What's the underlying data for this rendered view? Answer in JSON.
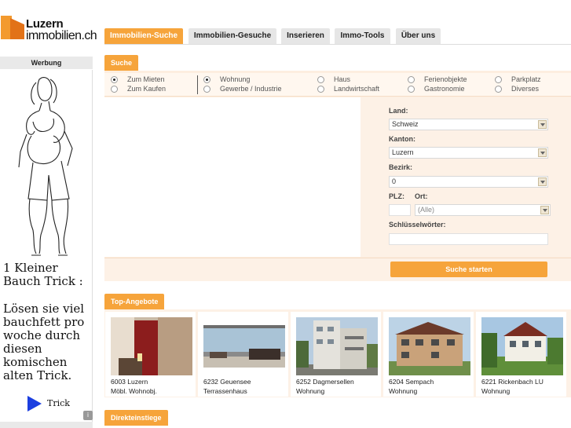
{
  "logo": {
    "line1": "Luzern",
    "line2": "immobilien.ch"
  },
  "ad": {
    "header": "Werbung",
    "headline": "1 Kleiner Bauch Trick :",
    "body": "Lösen sie viel bauchfett pro woche durch diesen komischen alten Trick.",
    "cta": "Trick",
    "info": "i"
  },
  "nav": {
    "tabs": [
      {
        "label": "Immobilien-Suche",
        "active": true
      },
      {
        "label": "Immobilien-Gesuche",
        "active": false
      },
      {
        "label": "Inserieren",
        "active": false
      },
      {
        "label": "Immo-Tools",
        "active": false
      },
      {
        "label": "Über uns",
        "active": false
      }
    ]
  },
  "search": {
    "tab_label": "Suche",
    "mode": [
      {
        "label": "Zum Mieten",
        "checked": true
      },
      {
        "label": "Zum Kaufen",
        "checked": false
      }
    ],
    "types": [
      {
        "label": "Wohnung",
        "checked": true
      },
      {
        "label": "Gewerbe / Industrie",
        "checked": false
      },
      {
        "label": "Haus",
        "checked": false
      },
      {
        "label": "Landwirtschaft",
        "checked": false
      },
      {
        "label": "Ferienobjekte",
        "checked": false
      },
      {
        "label": "Gastronomie",
        "checked": false
      },
      {
        "label": "Parkplatz",
        "checked": false
      },
      {
        "label": "Diverses",
        "checked": false
      }
    ],
    "land_label": "Land:",
    "land_value": "Schweiz",
    "kanton_label": "Kanton:",
    "kanton_value": "Luzern",
    "bezirk_label": "Bezirk:",
    "bezirk_value": "0",
    "plz_label": "PLZ:",
    "ort_label": "Ort:",
    "plz_value": "",
    "ort_value": "(Alle)",
    "keywords_label": "Schlüsselwörter:",
    "keywords_value": "",
    "submit_label": "Suche starten"
  },
  "offers": {
    "tab_label": "Top-Angebote",
    "items": [
      {
        "location": "6003 Luzern",
        "type": "Möbl. Wohnobj."
      },
      {
        "location": "6232 Geuensee",
        "type": "Terrassenhaus"
      },
      {
        "location": "6252 Dagmersellen",
        "type": "Wohnung"
      },
      {
        "location": "6204 Sempach",
        "type": "Wohnung"
      },
      {
        "location": "6221 Rickenbach LU",
        "type": "Wohnung"
      }
    ]
  },
  "direct": {
    "tab_label": "Direkteinstiege"
  },
  "colors": {
    "accent": "#f6a43b",
    "panel": "#fdf1e6",
    "logo_orange": "#e27218",
    "ad_arrow": "#1c3fe0"
  }
}
